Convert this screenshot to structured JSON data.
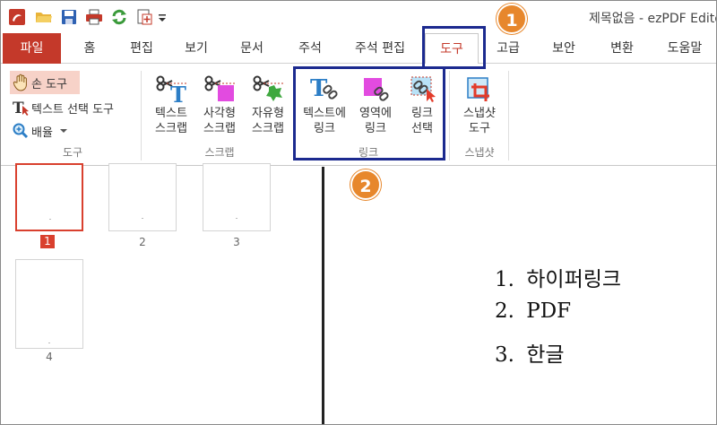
{
  "title": "제목없음 - ezPDF Edito",
  "tabs": [
    "파일",
    "홈",
    "편집",
    "보기",
    "문서",
    "주석",
    "주석 편집",
    "도구",
    "고급",
    "보안",
    "변환",
    "도움말"
  ],
  "active_tab": "도구",
  "ribbon": {
    "tools_group": {
      "hand": "손 도구",
      "text_select": "텍스트 선택 도구",
      "zoom": "배율",
      "label": "도구"
    },
    "scrap_group": {
      "text_scrap": [
        "텍스트",
        "스크랩"
      ],
      "rect_scrap": [
        "사각형",
        "스크랩"
      ],
      "free_scrap": [
        "자유형",
        "스크랩"
      ],
      "label": "스크랩"
    },
    "link_group": {
      "text_link": [
        "텍스트에",
        "링크"
      ],
      "area_link": [
        "영역에",
        "링크"
      ],
      "select_link": [
        "링크",
        "선택"
      ],
      "label": "링크"
    },
    "snapshot_group": {
      "snapshot": [
        "스냅샷",
        "도구"
      ],
      "label": "스냅샷"
    }
  },
  "pages": [
    "1",
    "2",
    "3",
    "4"
  ],
  "selected_page": "1",
  "document": {
    "lines": [
      {
        "num": "1.",
        "text": "하이퍼링크"
      },
      {
        "num": "2.",
        "text": "PDF"
      },
      {
        "num": "3.",
        "text": "한글"
      }
    ]
  },
  "callouts": [
    "1",
    "2"
  ],
  "colors": {
    "accent": "#c4392a",
    "highlight": "#1c2a8f",
    "badge": "#e7872c"
  }
}
